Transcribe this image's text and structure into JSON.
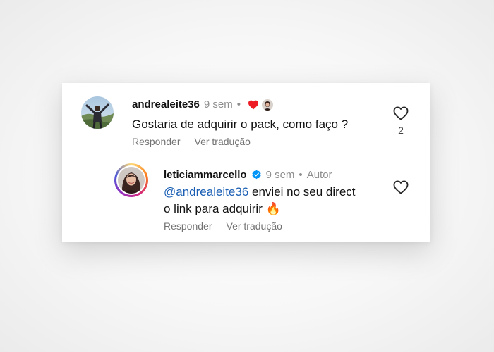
{
  "comments": [
    {
      "username": "andrealeite36",
      "time": "9 sem",
      "separator": "•",
      "text": "Gostaria de adquirir o pack, como faço ?",
      "actions": {
        "reply": "Responder",
        "translate": "Ver tradução"
      },
      "like_count": "2",
      "creator_liked": true
    },
    {
      "username": "leticiammarcello",
      "verified": true,
      "time": "9 sem",
      "separator": "•",
      "badge": "Autor",
      "mention": "@andrealeite36",
      "text_line1_rest": " enviei no seu direct",
      "text_line2": "o link para adquirir",
      "emoji": "🔥",
      "actions": {
        "reply": "Responder",
        "translate": "Ver tradução"
      }
    }
  ],
  "colors": {
    "mention": "#1a5fb4",
    "liked_heart": "#ed1c24",
    "verified": "#0095f6",
    "muted_text": "#8e8e8e"
  },
  "icons": {
    "like": "heart-outline-icon",
    "creator_like": "heart-filled-icon",
    "verified": "verified-badge-icon"
  }
}
